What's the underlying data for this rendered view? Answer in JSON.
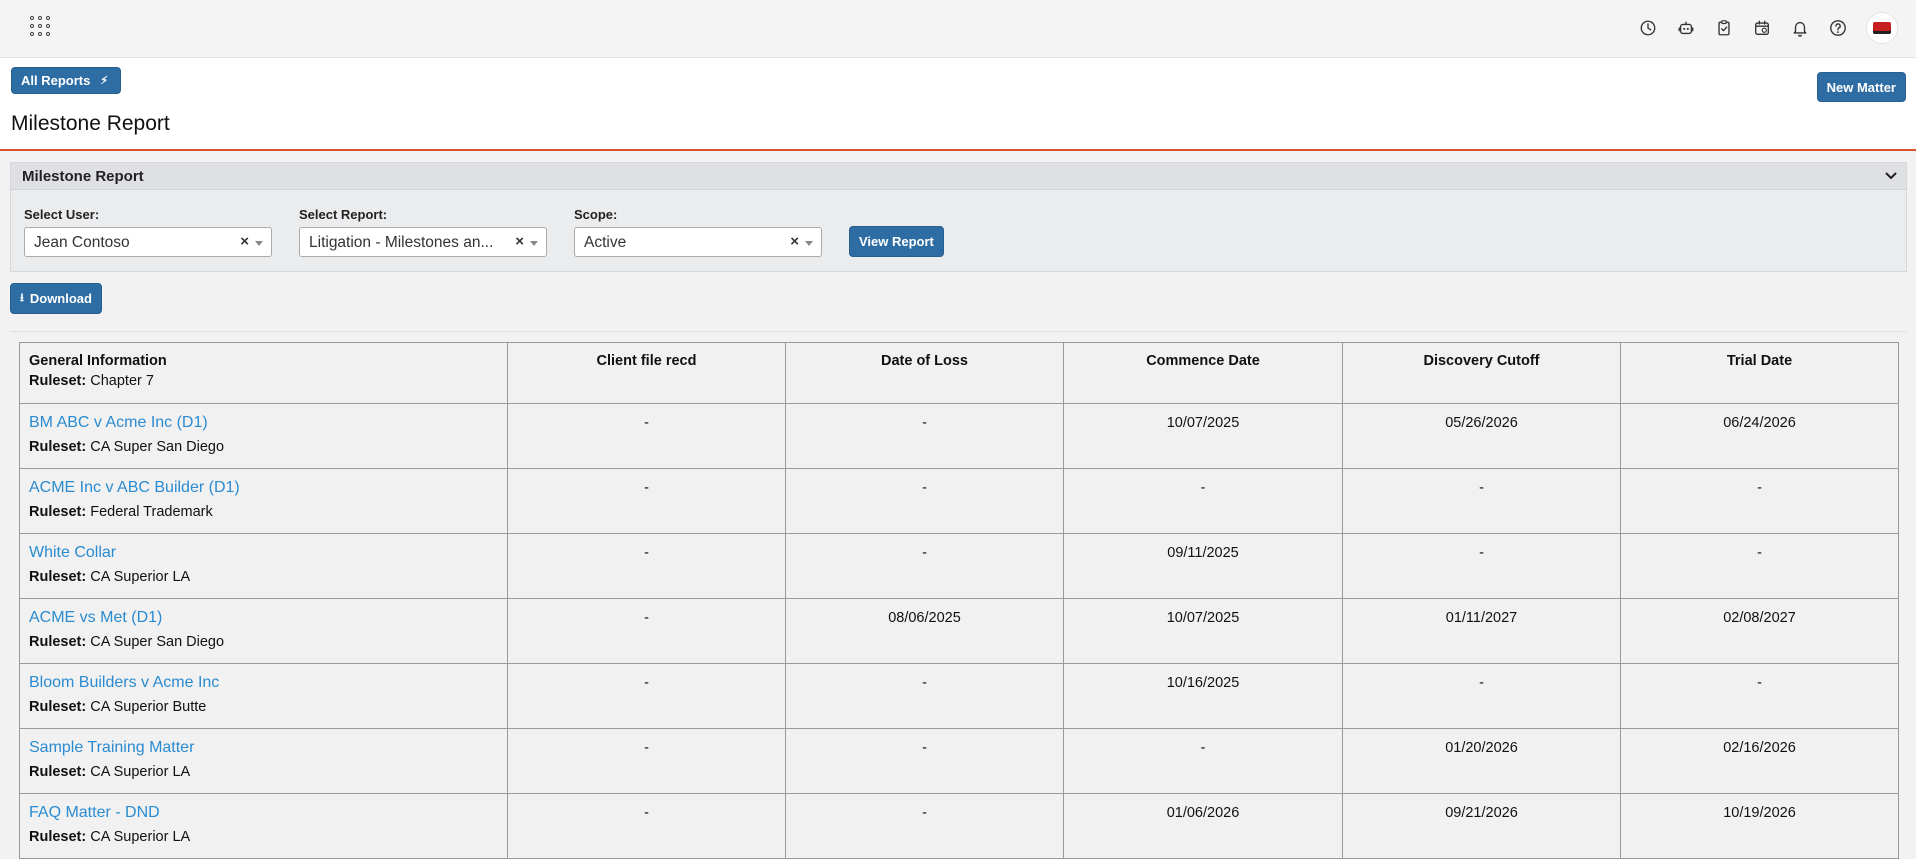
{
  "topbar": {
    "icons": [
      "clock-icon",
      "robot-icon",
      "clipboard-check-icon",
      "calendar-clock-icon",
      "bell-icon",
      "help-icon"
    ]
  },
  "header": {
    "all_reports_label": "All Reports",
    "new_matter_label": "New Matter",
    "page_title": "Milestone Report"
  },
  "panel": {
    "title": "Milestone Report",
    "user_label": "Select User:",
    "user_value": "Jean Contoso",
    "report_label": "Select Report:",
    "report_value": "Litigation - Milestones an...",
    "scope_label": "Scope:",
    "scope_value": "Active",
    "view_report_label": "View Report"
  },
  "download_label": "Download",
  "table": {
    "headers": [
      "General Information",
      "Client file recd",
      "Date of Loss",
      "Commence Date",
      "Discovery Cutoff",
      "Trial Date"
    ],
    "ruleset_label": "Ruleset:",
    "header_ruleset": "Chapter 7",
    "rows": [
      {
        "name": "BM ABC v Acme Inc (D1)",
        "ruleset": "CA Super San Diego",
        "client_file": "-",
        "date_of_loss": "-",
        "commence": "10/07/2025",
        "discovery": "05/26/2026",
        "trial": "06/24/2026"
      },
      {
        "name": "ACME Inc v ABC Builder (D1)",
        "ruleset": "Federal Trademark",
        "client_file": "-",
        "date_of_loss": "-",
        "commence": "-",
        "discovery": "-",
        "trial": "-"
      },
      {
        "name": "White Collar",
        "ruleset": "CA Superior LA",
        "client_file": "-",
        "date_of_loss": "-",
        "commence": "09/11/2025",
        "discovery": "-",
        "trial": "-"
      },
      {
        "name": "ACME vs Met (D1)",
        "ruleset": "CA Super San Diego",
        "client_file": "-",
        "date_of_loss": "08/06/2025",
        "commence": "10/07/2025",
        "discovery": "01/11/2027",
        "trial": "02/08/2027"
      },
      {
        "name": "Bloom Builders v Acme Inc",
        "ruleset": "CA Superior Butte",
        "client_file": "-",
        "date_of_loss": "-",
        "commence": "10/16/2025",
        "discovery": "-",
        "trial": "-"
      },
      {
        "name": "Sample Training Matter",
        "ruleset": "CA Superior LA",
        "client_file": "-",
        "date_of_loss": "-",
        "commence": "-",
        "discovery": "01/20/2026",
        "trial": "02/16/2026"
      },
      {
        "name": "FAQ Matter - DND",
        "ruleset": "CA Superior LA",
        "client_file": "-",
        "date_of_loss": "-",
        "commence": "01/06/2026",
        "discovery": "09/21/2026",
        "trial": "10/19/2026"
      }
    ]
  },
  "colors": {
    "primary_button": "#2e6da4",
    "title_rule": "#d9532f",
    "link": "#2a8bd0"
  }
}
